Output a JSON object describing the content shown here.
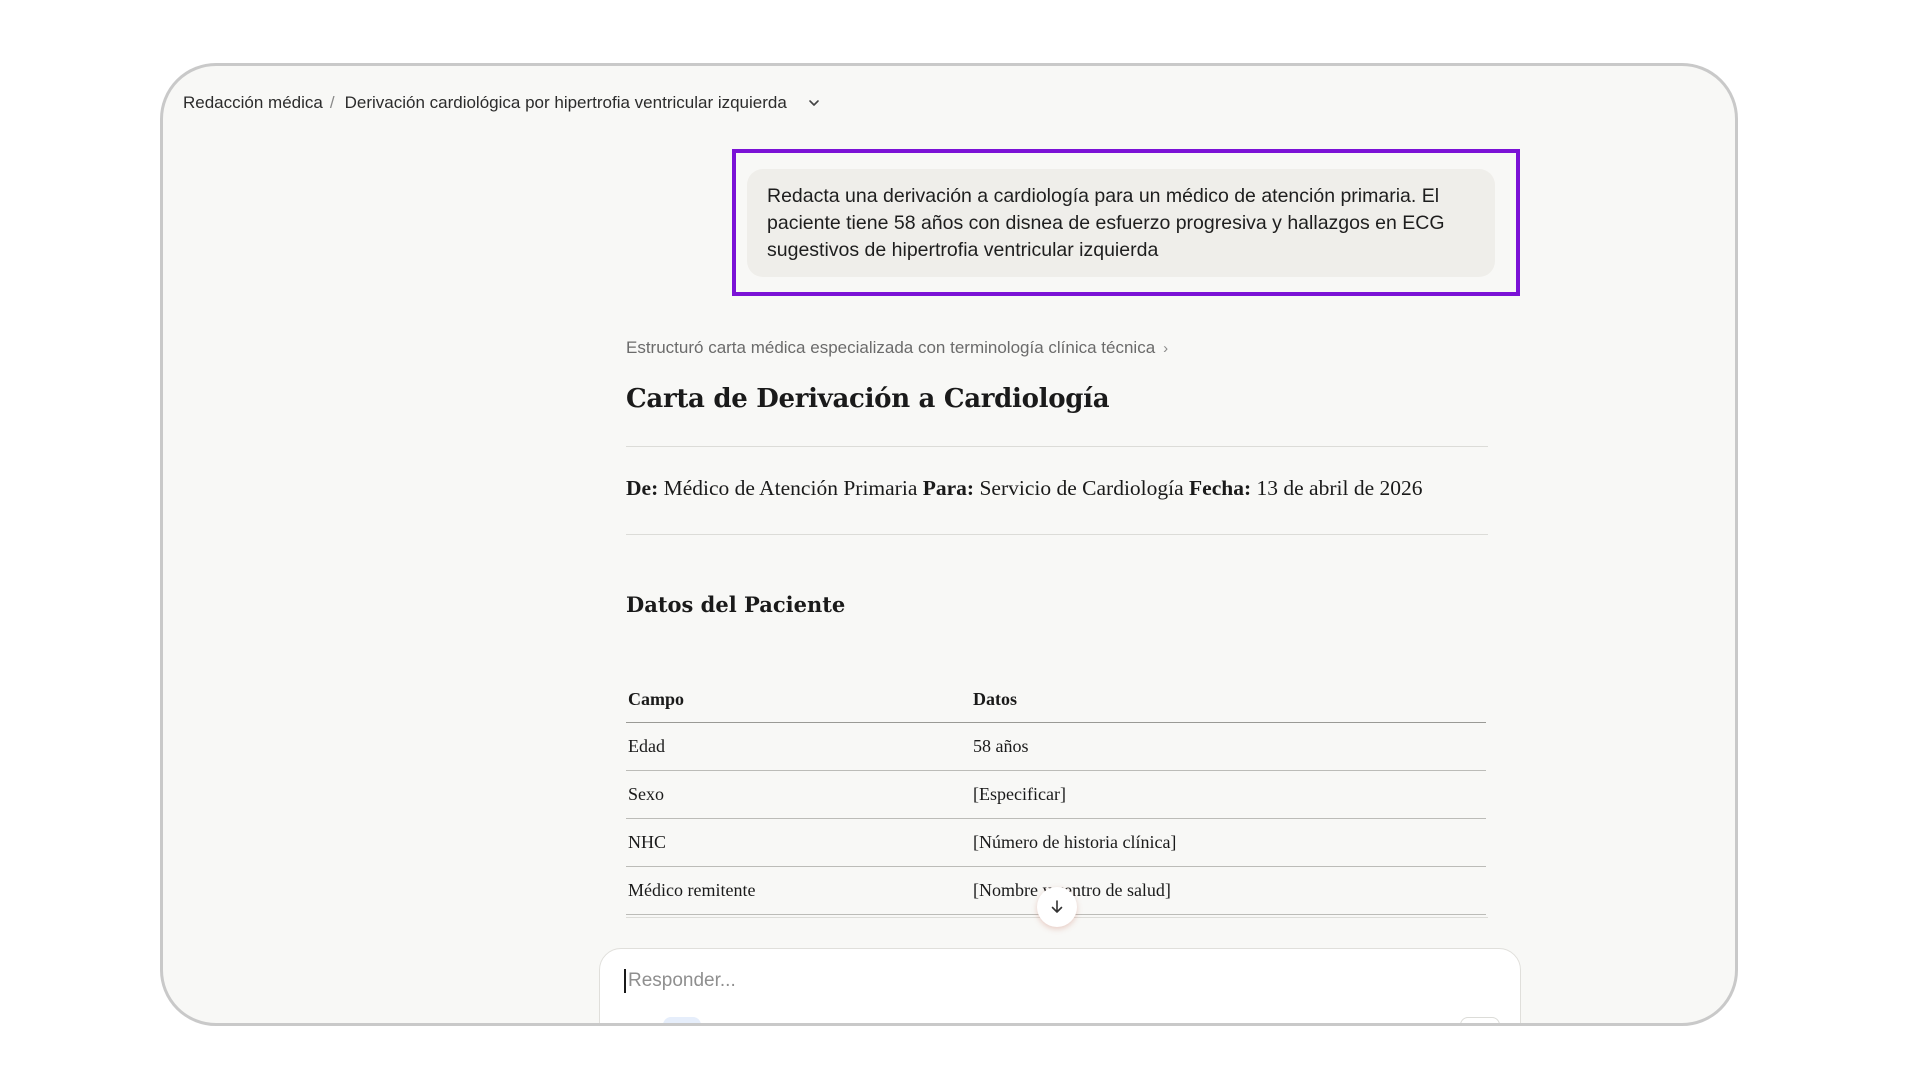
{
  "breadcrumb": {
    "root": "Redacción médica",
    "separator": "/",
    "current": "Derivación cardiológica por hipertrofia ventricular izquierda",
    "chevron_icon": "chevron-down-icon"
  },
  "user_message": {
    "text": "Redacta una derivación a cardiología para un médico de atención primaria. El paciente tiene 58 años con disnea de esfuerzo progresiva y hallazgos en ECG sugestivos de hipertrofia ventricular izquierda"
  },
  "thinking_summary": {
    "text": "Estructuró carta médica especializada con terminología clínica técnica",
    "arrow": "›"
  },
  "document": {
    "title": "Carta de Derivación a Cardiología",
    "meta": {
      "from_label": "De:",
      "from_value": "Médico de Atención Primaria",
      "to_label": "Para:",
      "to_value": "Servicio de Cardiología",
      "date_label": "Fecha:",
      "date_value": "13 de abril de 2026"
    },
    "patient_section": {
      "title": "Datos del Paciente",
      "columns": [
        "Campo",
        "Datos"
      ],
      "rows": [
        [
          "Edad",
          "58 años"
        ],
        [
          "Sexo",
          "[Especificar]"
        ],
        [
          "NHC",
          "[Número de historia clínica]"
        ],
        [
          "Médico remitente",
          "[Nombre y centro de salud]"
        ]
      ]
    }
  },
  "scroll_button": {
    "icon": "arrow-down-icon"
  },
  "composer": {
    "placeholder": "Responder...",
    "value": ""
  },
  "colors": {
    "highlight": "#7b12d6",
    "bubble": "#efeeea",
    "background": "#f8f8f6"
  }
}
